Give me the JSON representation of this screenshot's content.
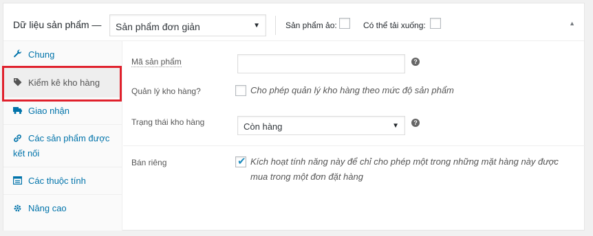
{
  "header": {
    "title": "Dữ liệu sản phẩm —",
    "product_type": "Sản phẩm đơn giản",
    "virtual_label": "Sản phẩm ảo:",
    "downloadable_label": "Có thể tải xuống:",
    "collapse_glyph": "▲"
  },
  "tabs": [
    {
      "label": "Chung",
      "icon": "wrench-icon"
    },
    {
      "label": "Kiểm kê kho hàng",
      "icon": "tag-icon"
    },
    {
      "label": "Giao nhận",
      "icon": "truck-icon"
    },
    {
      "label": "Các sản phẩm được kết nối",
      "icon": "link-icon"
    },
    {
      "label": "Các thuộc tính",
      "icon": "table-icon"
    },
    {
      "label": "Nâng cao",
      "icon": "gear-icon"
    }
  ],
  "fields": {
    "sku_label": "Mã sản phẩm",
    "sku_value": "",
    "manage_stock_label": "Quản lý kho hàng?",
    "manage_stock_desc": "Cho phép quản lý kho hàng theo mức độ sản phẩm",
    "stock_status_label": "Trạng thái kho hàng",
    "stock_status_value": "Còn hàng",
    "sold_individually_label": "Bán riêng",
    "sold_individually_desc": "Kích hoạt tính năng này để chỉ cho phép một trong những mặt hàng này được mua trong một đơn đặt hàng",
    "help_glyph": "?",
    "check_glyph": "✔"
  },
  "colors": {
    "accent": "#0073aa",
    "highlight": "#e0202c",
    "check": "#1e8cbe"
  }
}
